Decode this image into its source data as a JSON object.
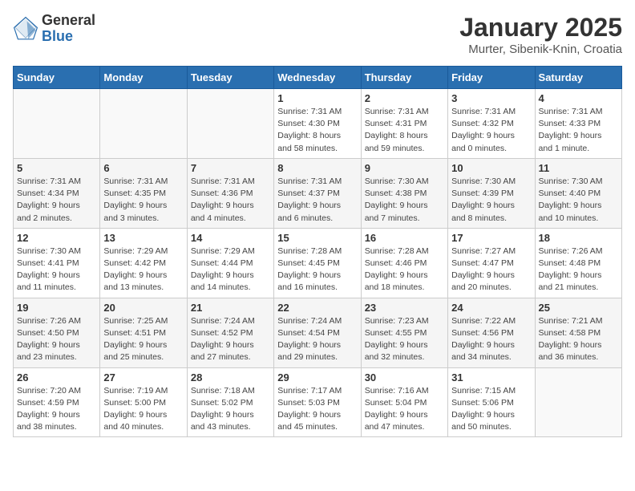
{
  "logo": {
    "general": "General",
    "blue": "Blue"
  },
  "title": "January 2025",
  "subtitle": "Murter, Sibenik-Knin, Croatia",
  "days_of_week": [
    "Sunday",
    "Monday",
    "Tuesday",
    "Wednesday",
    "Thursday",
    "Friday",
    "Saturday"
  ],
  "weeks": [
    [
      {
        "day": "",
        "detail": ""
      },
      {
        "day": "",
        "detail": ""
      },
      {
        "day": "",
        "detail": ""
      },
      {
        "day": "1",
        "detail": "Sunrise: 7:31 AM\nSunset: 4:30 PM\nDaylight: 8 hours\nand 58 minutes."
      },
      {
        "day": "2",
        "detail": "Sunrise: 7:31 AM\nSunset: 4:31 PM\nDaylight: 8 hours\nand 59 minutes."
      },
      {
        "day": "3",
        "detail": "Sunrise: 7:31 AM\nSunset: 4:32 PM\nDaylight: 9 hours\nand 0 minutes."
      },
      {
        "day": "4",
        "detail": "Sunrise: 7:31 AM\nSunset: 4:33 PM\nDaylight: 9 hours\nand 1 minute."
      }
    ],
    [
      {
        "day": "5",
        "detail": "Sunrise: 7:31 AM\nSunset: 4:34 PM\nDaylight: 9 hours\nand 2 minutes."
      },
      {
        "day": "6",
        "detail": "Sunrise: 7:31 AM\nSunset: 4:35 PM\nDaylight: 9 hours\nand 3 minutes."
      },
      {
        "day": "7",
        "detail": "Sunrise: 7:31 AM\nSunset: 4:36 PM\nDaylight: 9 hours\nand 4 minutes."
      },
      {
        "day": "8",
        "detail": "Sunrise: 7:31 AM\nSunset: 4:37 PM\nDaylight: 9 hours\nand 6 minutes."
      },
      {
        "day": "9",
        "detail": "Sunrise: 7:30 AM\nSunset: 4:38 PM\nDaylight: 9 hours\nand 7 minutes."
      },
      {
        "day": "10",
        "detail": "Sunrise: 7:30 AM\nSunset: 4:39 PM\nDaylight: 9 hours\nand 8 minutes."
      },
      {
        "day": "11",
        "detail": "Sunrise: 7:30 AM\nSunset: 4:40 PM\nDaylight: 9 hours\nand 10 minutes."
      }
    ],
    [
      {
        "day": "12",
        "detail": "Sunrise: 7:30 AM\nSunset: 4:41 PM\nDaylight: 9 hours\nand 11 minutes."
      },
      {
        "day": "13",
        "detail": "Sunrise: 7:29 AM\nSunset: 4:42 PM\nDaylight: 9 hours\nand 13 minutes."
      },
      {
        "day": "14",
        "detail": "Sunrise: 7:29 AM\nSunset: 4:44 PM\nDaylight: 9 hours\nand 14 minutes."
      },
      {
        "day": "15",
        "detail": "Sunrise: 7:28 AM\nSunset: 4:45 PM\nDaylight: 9 hours\nand 16 minutes."
      },
      {
        "day": "16",
        "detail": "Sunrise: 7:28 AM\nSunset: 4:46 PM\nDaylight: 9 hours\nand 18 minutes."
      },
      {
        "day": "17",
        "detail": "Sunrise: 7:27 AM\nSunset: 4:47 PM\nDaylight: 9 hours\nand 20 minutes."
      },
      {
        "day": "18",
        "detail": "Sunrise: 7:26 AM\nSunset: 4:48 PM\nDaylight: 9 hours\nand 21 minutes."
      }
    ],
    [
      {
        "day": "19",
        "detail": "Sunrise: 7:26 AM\nSunset: 4:50 PM\nDaylight: 9 hours\nand 23 minutes."
      },
      {
        "day": "20",
        "detail": "Sunrise: 7:25 AM\nSunset: 4:51 PM\nDaylight: 9 hours\nand 25 minutes."
      },
      {
        "day": "21",
        "detail": "Sunrise: 7:24 AM\nSunset: 4:52 PM\nDaylight: 9 hours\nand 27 minutes."
      },
      {
        "day": "22",
        "detail": "Sunrise: 7:24 AM\nSunset: 4:54 PM\nDaylight: 9 hours\nand 29 minutes."
      },
      {
        "day": "23",
        "detail": "Sunrise: 7:23 AM\nSunset: 4:55 PM\nDaylight: 9 hours\nand 32 minutes."
      },
      {
        "day": "24",
        "detail": "Sunrise: 7:22 AM\nSunset: 4:56 PM\nDaylight: 9 hours\nand 34 minutes."
      },
      {
        "day": "25",
        "detail": "Sunrise: 7:21 AM\nSunset: 4:58 PM\nDaylight: 9 hours\nand 36 minutes."
      }
    ],
    [
      {
        "day": "26",
        "detail": "Sunrise: 7:20 AM\nSunset: 4:59 PM\nDaylight: 9 hours\nand 38 minutes."
      },
      {
        "day": "27",
        "detail": "Sunrise: 7:19 AM\nSunset: 5:00 PM\nDaylight: 9 hours\nand 40 minutes."
      },
      {
        "day": "28",
        "detail": "Sunrise: 7:18 AM\nSunset: 5:02 PM\nDaylight: 9 hours\nand 43 minutes."
      },
      {
        "day": "29",
        "detail": "Sunrise: 7:17 AM\nSunset: 5:03 PM\nDaylight: 9 hours\nand 45 minutes."
      },
      {
        "day": "30",
        "detail": "Sunrise: 7:16 AM\nSunset: 5:04 PM\nDaylight: 9 hours\nand 47 minutes."
      },
      {
        "day": "31",
        "detail": "Sunrise: 7:15 AM\nSunset: 5:06 PM\nDaylight: 9 hours\nand 50 minutes."
      },
      {
        "day": "",
        "detail": ""
      }
    ]
  ]
}
